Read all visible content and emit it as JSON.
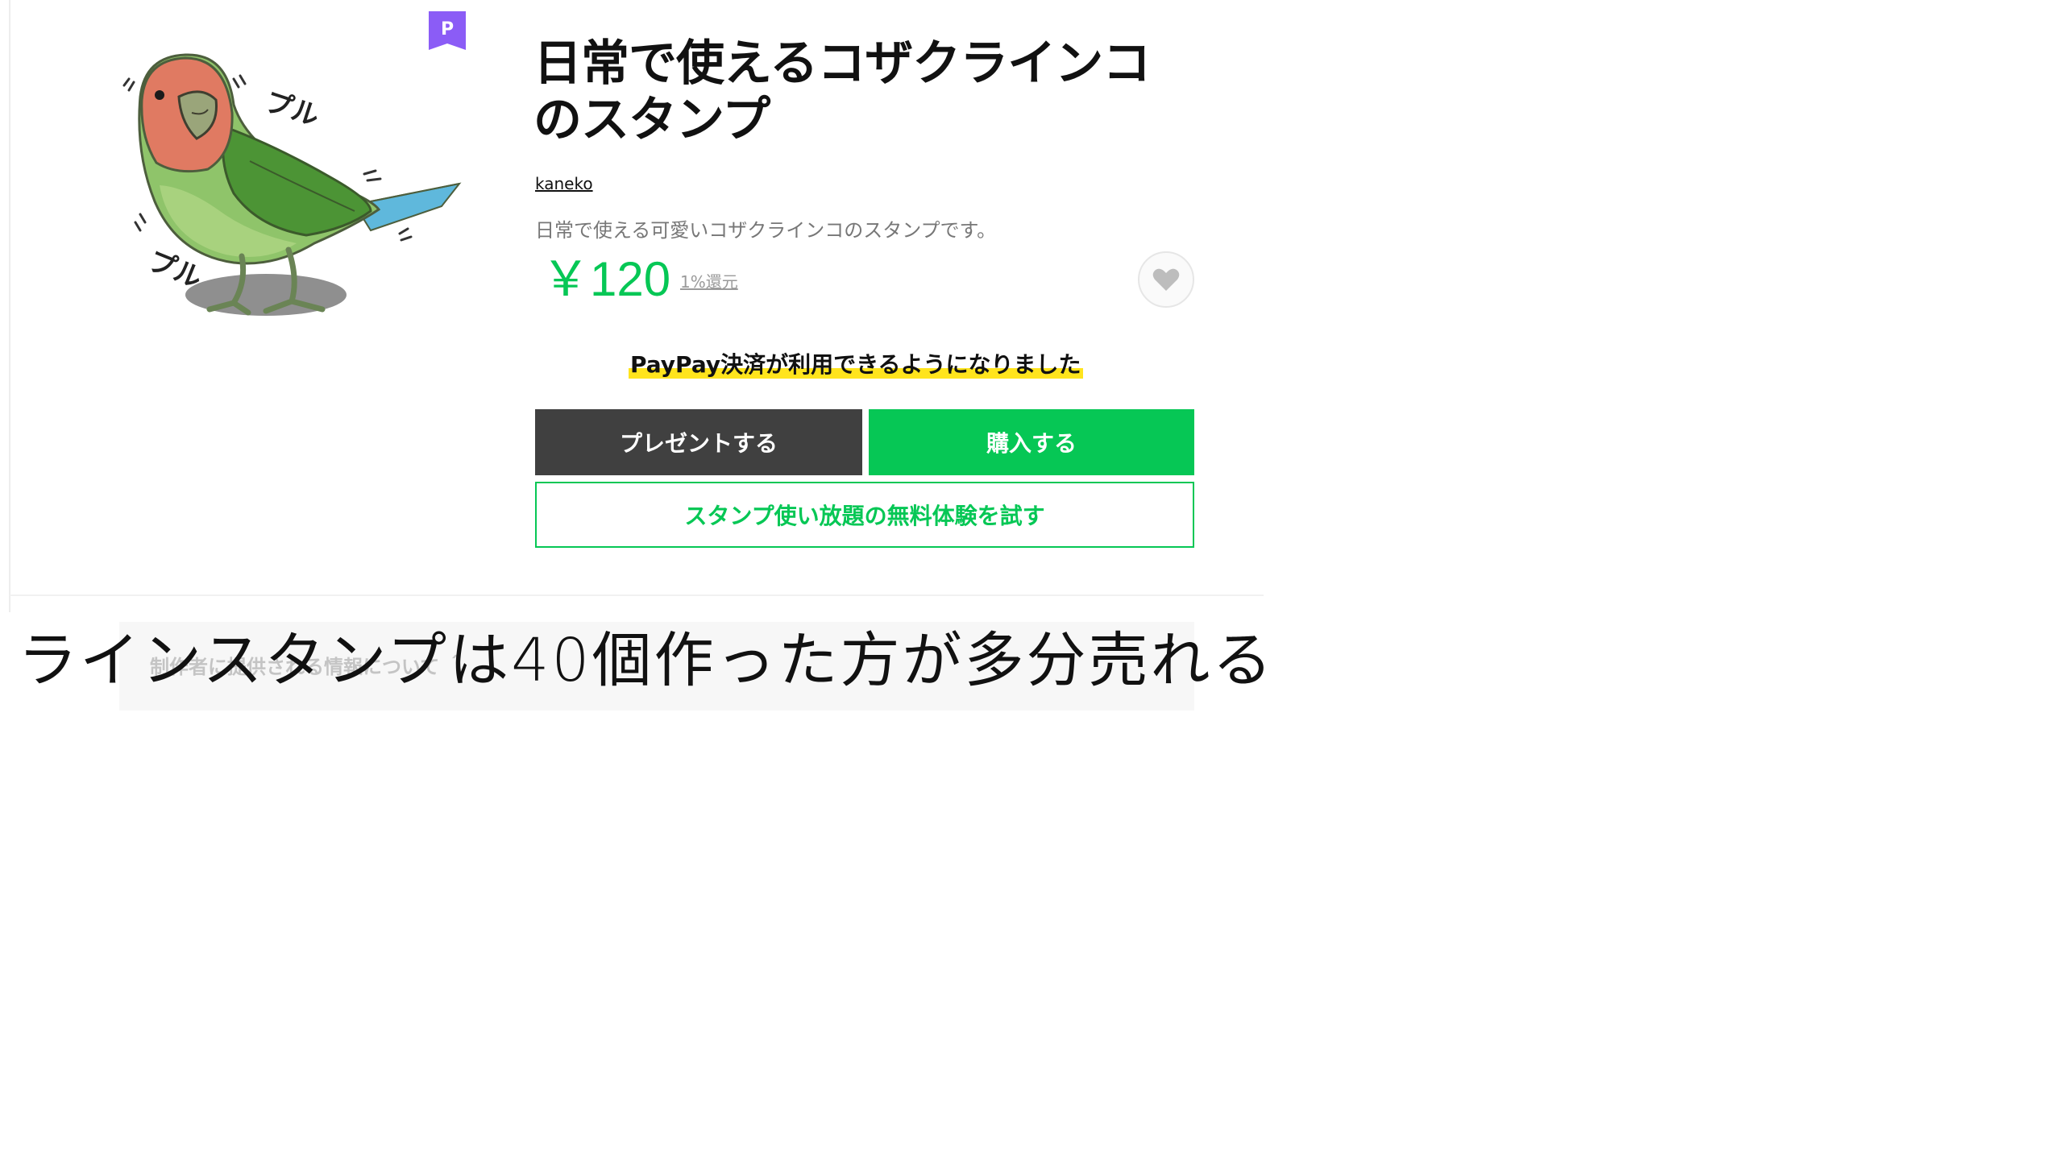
{
  "product": {
    "title_line1": "日常で使えるコザクラインコ",
    "title_line2": "のスタンプ",
    "author": "kaneko",
    "description": "日常で使える可愛いコザクラインコのスタンプです。",
    "price": "￥120",
    "cashback": "1%還元",
    "premium_badge": "P"
  },
  "sticker": {
    "sfx_top": "プル",
    "sfx_bottom": "プル"
  },
  "notice": {
    "paypay": "PayPay決済が利用できるようになりました"
  },
  "buttons": {
    "present": "プレゼントする",
    "buy": "購入する",
    "trial": "スタンプ使い放題の無料体験を試す"
  },
  "footer": {
    "creator_info": "制作者に提供される情報について ＾"
  },
  "caption": "ラインスタンプは40個作った方が多分売れる",
  "colors": {
    "line_green": "#06c755",
    "dark_button": "#404040",
    "premium_purple": "#8b5cf6",
    "highlight_yellow": "#ffe41d"
  },
  "icons": {
    "favorite": "heart-icon",
    "premium": "premium-badge-icon"
  }
}
